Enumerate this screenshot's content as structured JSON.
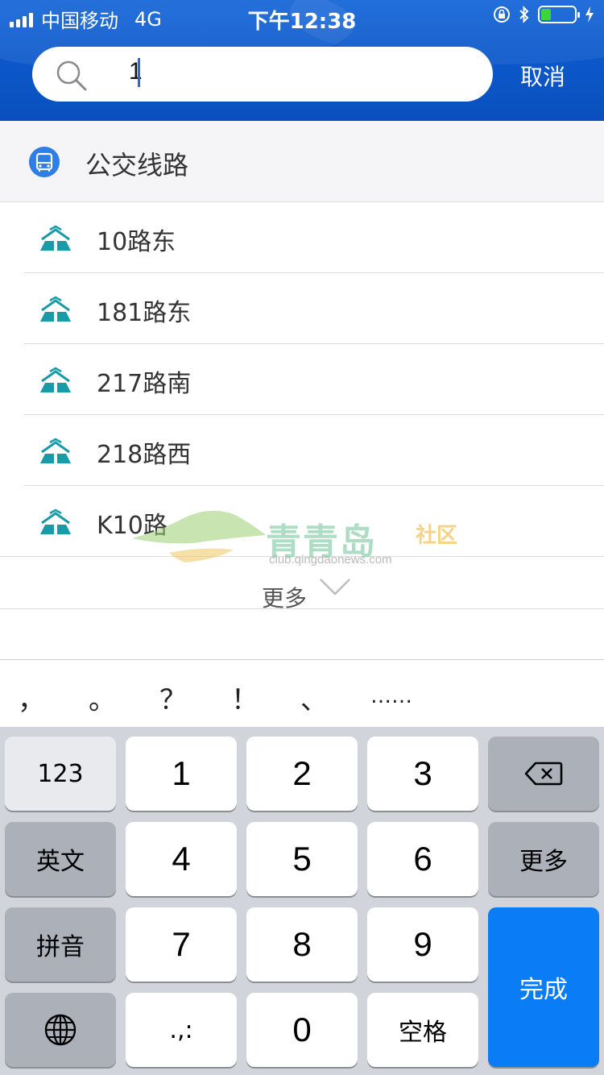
{
  "status_bar": {
    "carrier": "中国移动",
    "network": "4G",
    "time": "下午12:38",
    "battery_color": "#3cd63a"
  },
  "search": {
    "value": "1",
    "cancel_label": "取消"
  },
  "section": {
    "title": "公交线路",
    "icon": "bus-icon"
  },
  "results": [
    {
      "label": "10路东",
      "icon": "route-icon"
    },
    {
      "label": "181路东",
      "icon": "route-icon"
    },
    {
      "label": "217路南",
      "icon": "route-icon"
    },
    {
      "label": "218路西",
      "icon": "route-icon"
    },
    {
      "label": "K10路",
      "icon": "route-icon"
    }
  ],
  "more": {
    "label": "更多",
    "icon": "chevron-down-icon"
  },
  "watermark": {
    "title": "青青岛",
    "sub": "社区",
    "url": "club.qingdaonews.com"
  },
  "candidates": [
    "，",
    "。",
    "？",
    "！",
    "、",
    "……"
  ],
  "keyboard": {
    "k123": "123",
    "k1": "1",
    "k2": "2",
    "k3": "3",
    "english": "英文",
    "k4": "4",
    "k5": "5",
    "k6": "6",
    "more": "更多",
    "pinyin": "拼音",
    "k7": "7",
    "k8": "8",
    "k9": "9",
    "done": "完成",
    "punct": ".,:",
    "k0": "0",
    "space": "空格",
    "accent": "#0a7cf6"
  }
}
